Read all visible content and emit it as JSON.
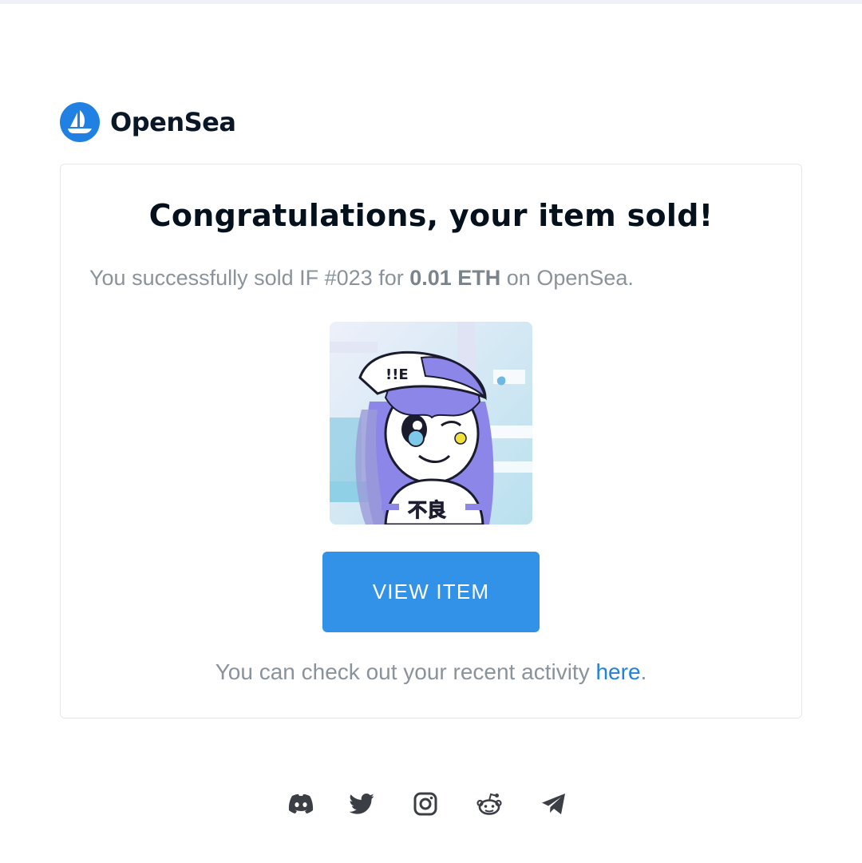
{
  "brand": {
    "name": "OpenSea",
    "accent": "#2081e2"
  },
  "card": {
    "headline": "Congratulations, your item sold!",
    "sold_prefix": "You successfully sold IF #023 for ",
    "sold_price": "0.01 ETH",
    "sold_suffix": " on OpenSea.",
    "item_image_icon": "nft-artwork",
    "view_button": "VIEW ITEM",
    "activity_prefix": "You can check out your recent activity ",
    "activity_link": "here",
    "activity_suffix": "."
  },
  "footer": {
    "socials": [
      "discord-icon",
      "twitter-icon",
      "instagram-icon",
      "reddit-icon",
      "telegram-icon"
    ]
  },
  "colors": {
    "button": "#3292e8",
    "text_muted": "#8a939b",
    "headline": "#04111d"
  }
}
